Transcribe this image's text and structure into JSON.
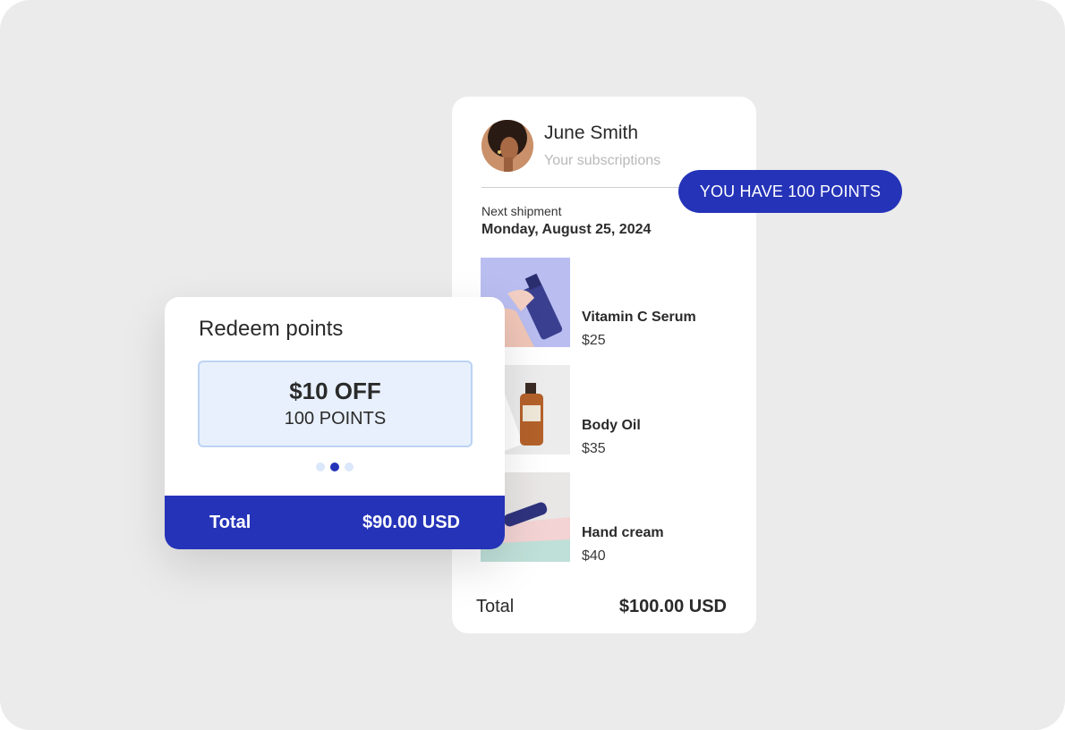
{
  "user": {
    "name": "June Smith",
    "subtitle": "Your subscriptions"
  },
  "shipment": {
    "label": "Next shipment",
    "date": "Monday, August 25, 2024"
  },
  "products": [
    {
      "name": "Vitamin C Serum",
      "price": "$25",
      "image": "serum-bottle-image"
    },
    {
      "name": "Body Oil",
      "price": "$35",
      "image": "oil-bottle-image"
    },
    {
      "name": "Hand cream",
      "price": "$40",
      "image": "hand-cream-image"
    }
  ],
  "subscription_total": {
    "label": "Total",
    "value": "$100.00 USD"
  },
  "points_badge": "YOU HAVE 100 POINTS",
  "redeem": {
    "title": "Redeem points",
    "offer_amount": "$10 OFF",
    "offer_points": "100 POINTS",
    "carousel": {
      "count": 3,
      "active_index": 1
    },
    "total_label": "Total",
    "total_value": "$90.00 USD"
  },
  "colors": {
    "accent": "#2533b8",
    "offer_bg": "#e8f0fd",
    "page_bg": "#ebebeb"
  }
}
